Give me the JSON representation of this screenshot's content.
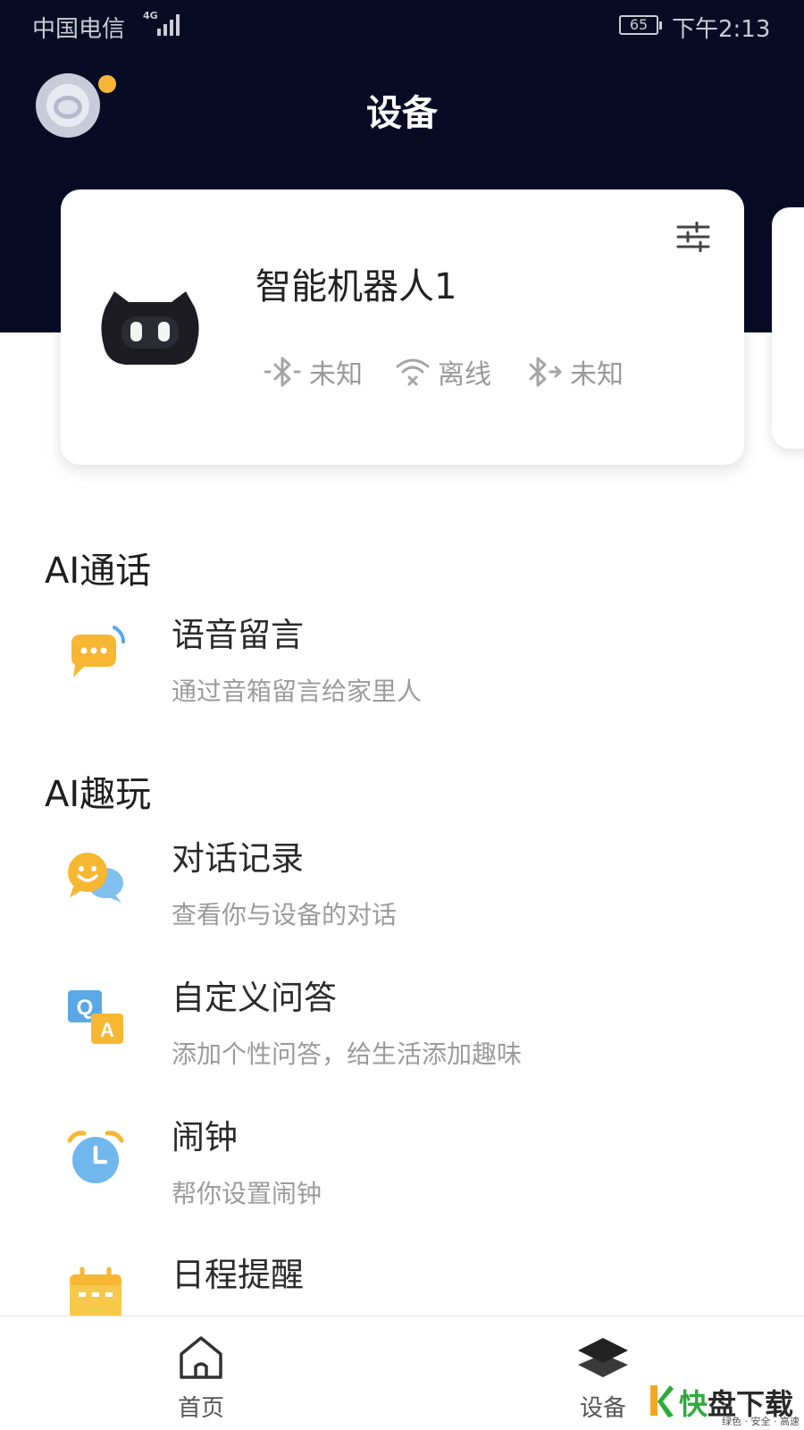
{
  "status_bar": {
    "carrier": "中国电信",
    "network": "4G",
    "battery": "65",
    "time": "下午2:13"
  },
  "header": {
    "title": "设备"
  },
  "device": {
    "name": "智能机器人1",
    "statuses": [
      {
        "icon": "bluetooth-icon",
        "label": "未知"
      },
      {
        "icon": "wifi-off-icon",
        "label": "离线"
      },
      {
        "icon": "bluetooth-icon",
        "label": "未知"
      }
    ]
  },
  "sections": [
    {
      "title": "AI通话",
      "items": [
        {
          "icon": "voice-message-icon",
          "title": "语音留言",
          "subtitle": "通过音箱留言给家里人"
        }
      ]
    },
    {
      "title": "AI趣玩",
      "items": [
        {
          "icon": "chat-history-icon",
          "title": "对话记录",
          "subtitle": "查看你与设备的对话"
        },
        {
          "icon": "qa-icon",
          "title": "自定义问答",
          "subtitle": "添加个性问答，给生活添加趣味"
        },
        {
          "icon": "alarm-clock-icon",
          "title": "闹钟",
          "subtitle": "帮你设置闹钟"
        },
        {
          "icon": "calendar-icon",
          "title": "日程提醒",
          "subtitle": ""
        }
      ]
    }
  ],
  "bottom_nav": {
    "home": "首页",
    "device": "设备"
  },
  "watermark": {
    "brand_kuai": "快",
    "brand_rest": "盘下载",
    "tagline": "绿色 · 安全 · 高速"
  },
  "colors": {
    "header_bg": "#070b24",
    "accent_yellow": "#f5b638",
    "icon_blue": "#5aa8e6"
  }
}
